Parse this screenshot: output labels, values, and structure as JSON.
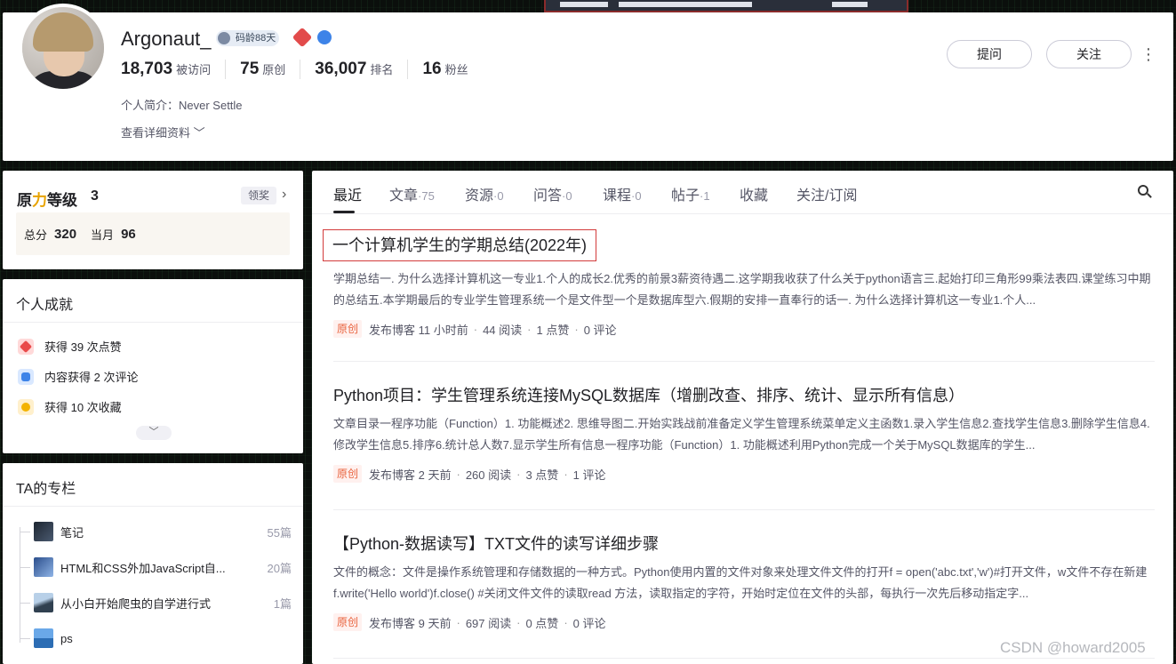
{
  "profile": {
    "username": "Argonaut_",
    "code_age_badge": "码龄88天",
    "stats": [
      {
        "value": "18,703",
        "label": "被访问"
      },
      {
        "value": "75",
        "label": "原创"
      },
      {
        "value": "36,007",
        "label": "排名"
      },
      {
        "value": "16",
        "label": "粉丝"
      }
    ],
    "bio": "个人简介：Never Settle",
    "more_info": "查看详细资料",
    "ask_button": "提问",
    "follow_button": "关注"
  },
  "level": {
    "title_a": "原",
    "title_b": "力",
    "title_c": "等级",
    "level": "3",
    "claim": "领奖",
    "total_label": "总分",
    "total": "320",
    "month_label": "当月",
    "month": "96"
  },
  "achievements": {
    "title": "个人成就",
    "items": [
      {
        "text": "获得 39 次点赞",
        "icon": "like-medal-icon"
      },
      {
        "text": "内容获得 2 次评论",
        "icon": "comment-medal-icon"
      },
      {
        "text": "获得 10 次收藏",
        "icon": "favorite-medal-icon"
      }
    ]
  },
  "columns": {
    "title": "TA的专栏",
    "items": [
      {
        "title": "笔记",
        "count": "55篇"
      },
      {
        "title": "HTML和CSS外加JavaScript自...",
        "count": "20篇"
      },
      {
        "title": "从小白开始爬虫的自学进行式",
        "count": "1篇"
      },
      {
        "title": "ps",
        "count": ""
      }
    ]
  },
  "tabs": [
    {
      "label": "最近",
      "count": ""
    },
    {
      "label": "文章",
      "count": "·75"
    },
    {
      "label": "资源",
      "count": "·0"
    },
    {
      "label": "问答",
      "count": "·0"
    },
    {
      "label": "课程",
      "count": "·0"
    },
    {
      "label": "帖子",
      "count": "·1"
    },
    {
      "label": "收藏",
      "count": ""
    },
    {
      "label": "关注/订阅",
      "count": ""
    }
  ],
  "articles": [
    {
      "title": "一个计算机学生的学期总结(2022年)",
      "desc": "学期总结一. 为什么选择计算机这一专业1.个人的成长2.优秀的前景3薪资待遇二.这学期我收获了什么关于python语言三.起始打印三角形99乘法表四.课堂练习中期的总结五.本学期最后的专业学生管理系统一个是文件型一个是数据库型六.假期的安排一直奉行的话一. 为什么选择计算机这一专业1.个人...",
      "tag": "原创",
      "published": "发布博客 11 小时前",
      "reads": "44 阅读",
      "likes": "1 点赞",
      "comments": "0 评论"
    },
    {
      "title": "Python项目：学生管理系统连接MySQL数据库（增删改查、排序、统计、显示所有信息）",
      "desc": "文章目录一程序功能（Function）1. 功能概述2. 思维导图二.开始实践战前准备定义学生管理系统菜单定义主函数1.录入学生信息2.查找学生信息3.删除学生信息4.修改学生信息5.排序6.统计总人数7.显示学生所有信息一程序功能（Function）1. 功能概述利用Python完成一个关于MySQL数据库的学生...",
      "tag": "原创",
      "published": "发布博客 2 天前",
      "reads": "260 阅读",
      "likes": "3 点赞",
      "comments": "1 评论"
    },
    {
      "title": "【Python-数据读写】TXT文件的读写详细步骤",
      "desc": "文件的概念：文件是操作系统管理和存储数据的一种方式。Python使用内置的文件对象来处理文件文件的打开f = open('abc.txt','w')#打开文件，w文件不存在新建f.write('Hello world')f.close() #关闭文件文件的读取read 方法，读取指定的字符，开始时定位在文件的头部，每执行一次先后移动指定字...",
      "tag": "原创",
      "published": "发布博客 9 天前",
      "reads": "697 阅读",
      "likes": "0 点赞",
      "comments": "0 评论"
    }
  ],
  "watermark": "CSDN @howard2005"
}
